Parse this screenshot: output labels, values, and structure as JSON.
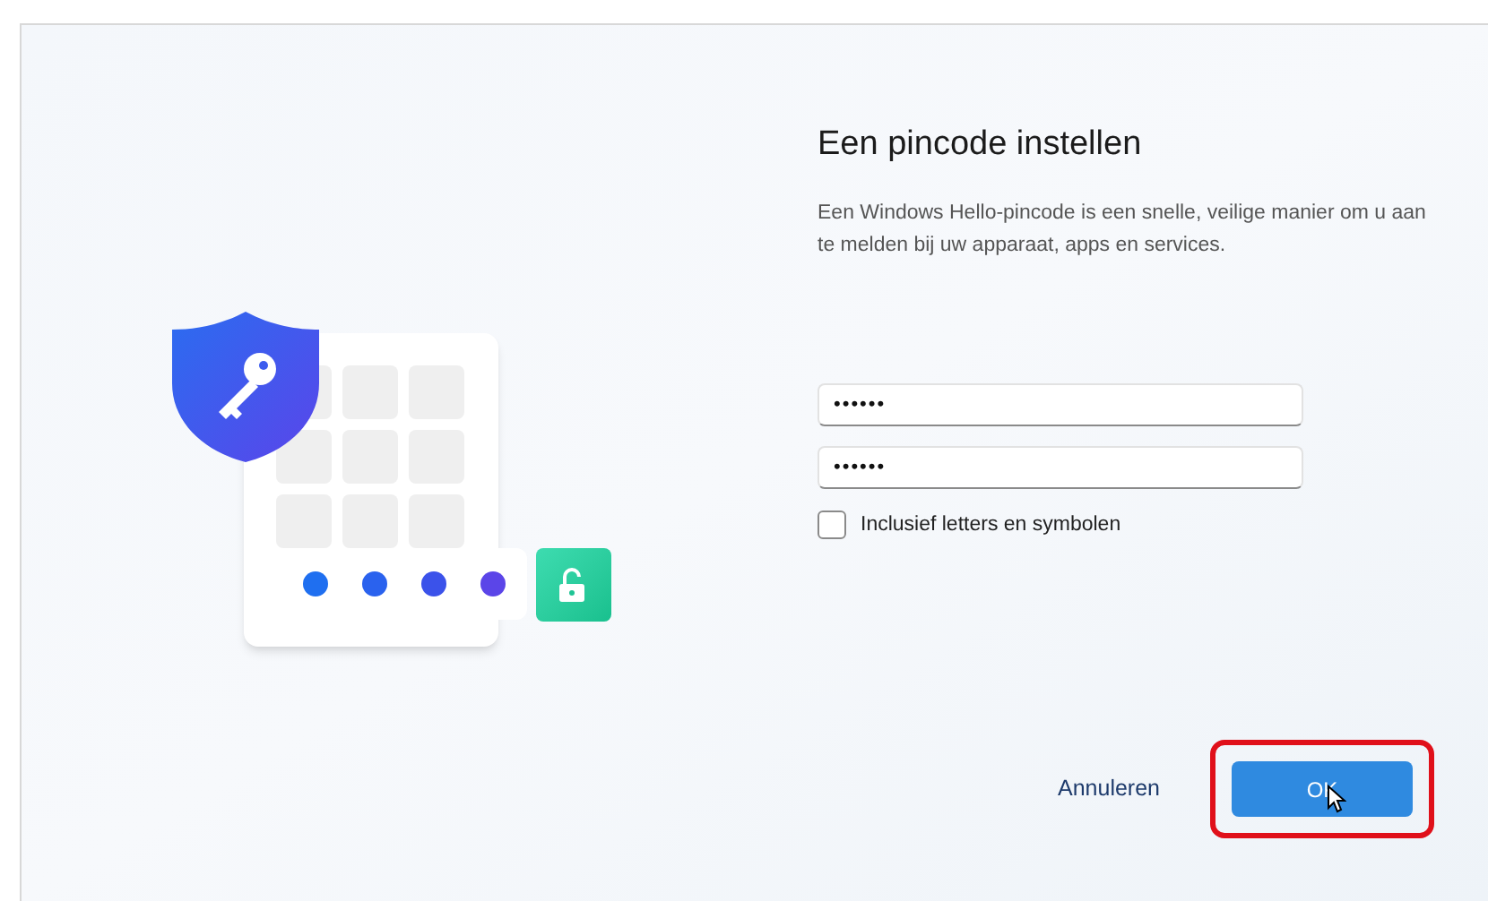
{
  "title": "Een pincode instellen",
  "description": "Een Windows Hello-pincode is een snelle, veilige manier om u aan te melden bij uw apparaat, apps en services.",
  "fields": [
    {
      "value": "••••••"
    },
    {
      "value": "••••••"
    }
  ],
  "checkbox": {
    "label": "Inclusief letters en symbolen",
    "checked": false
  },
  "cancel_button": {
    "label": "Annuleren"
  },
  "ok_button": {
    "label": "OK",
    "highlighted": true
  }
}
